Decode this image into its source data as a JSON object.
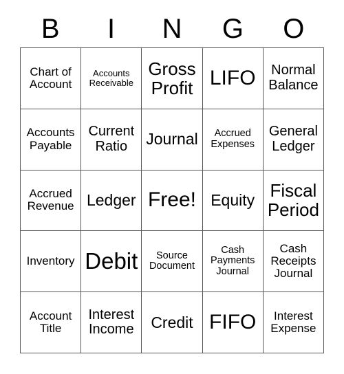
{
  "card": {
    "title_letters": [
      "B",
      "I",
      "N",
      "G",
      "O"
    ],
    "free_space_label": "Free!",
    "grid": [
      [
        {
          "text": "Chart of Account",
          "size": "fs-m"
        },
        {
          "text": "Accounts Receivable",
          "size": "fs-xs"
        },
        {
          "text": "Gross Profit",
          "size": "fs-xxl"
        },
        {
          "text": "LIFO",
          "size": "fs-3xl"
        },
        {
          "text": "Normal Balance",
          "size": "fs-l"
        }
      ],
      [
        {
          "text": "Accounts Payable",
          "size": "fs-m"
        },
        {
          "text": "Current Ratio",
          "size": "fs-l"
        },
        {
          "text": "Journal",
          "size": "fs-xl"
        },
        {
          "text": "Accrued Expenses",
          "size": "fs-s"
        },
        {
          "text": "General Ledger",
          "size": "fs-l"
        }
      ],
      [
        {
          "text": "Accrued Revenue",
          "size": "fs-m"
        },
        {
          "text": "Ledger",
          "size": "fs-xl"
        },
        {
          "text": "Free!",
          "size": "fs-3xl"
        },
        {
          "text": "Equity",
          "size": "fs-xl"
        },
        {
          "text": "Fiscal Period",
          "size": "fs-xxl"
        }
      ],
      [
        {
          "text": "Inventory",
          "size": "fs-m"
        },
        {
          "text": "Debit",
          "size": "fs-4xl"
        },
        {
          "text": "Source Document",
          "size": "fs-s"
        },
        {
          "text": "Cash Payments Journal",
          "size": "fs-s"
        },
        {
          "text": "Cash Receipts Journal",
          "size": "fs-m"
        }
      ],
      [
        {
          "text": "Account Title",
          "size": "fs-m"
        },
        {
          "text": "Interest Income",
          "size": "fs-l"
        },
        {
          "text": "Credit",
          "size": "fs-xl"
        },
        {
          "text": "FIFO",
          "size": "fs-3xl"
        },
        {
          "text": "Interest Expense",
          "size": "fs-m"
        }
      ]
    ]
  },
  "colors": {
    "background": "#ffffff",
    "text": "#000000",
    "grid_line": "#555555"
  }
}
